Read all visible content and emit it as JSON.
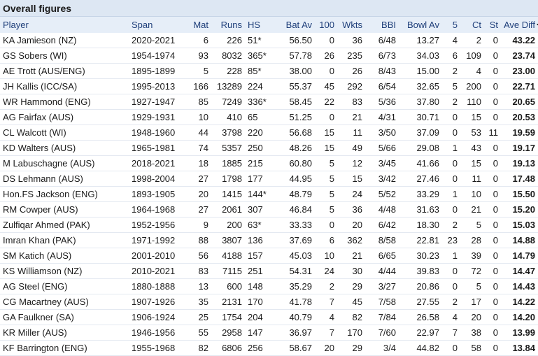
{
  "caption": "Overall figures",
  "columns": {
    "player": "Player",
    "span": "Span",
    "mat": "Mat",
    "runs": "Runs",
    "hs": "HS",
    "batav": "Bat Av",
    "hundreds": "100",
    "wkts": "Wkts",
    "bbi": "BBI",
    "bowlav": "Bowl Av",
    "five": "5",
    "ct": "Ct",
    "st": "St",
    "avediff": "Ave Diff"
  },
  "rows": [
    {
      "player": "KA Jamieson (NZ)",
      "span": "2020-2021",
      "mat": "6",
      "runs": "226",
      "hs": "51*",
      "batav": "56.50",
      "hundreds": "0",
      "wkts": "36",
      "bbi": "6/48",
      "bowlav": "13.27",
      "five": "4",
      "ct": "2",
      "st": "0",
      "avediff": "43.22"
    },
    {
      "player": "GS Sobers (WI)",
      "span": "1954-1974",
      "mat": "93",
      "runs": "8032",
      "hs": "365*",
      "batav": "57.78",
      "hundreds": "26",
      "wkts": "235",
      "bbi": "6/73",
      "bowlav": "34.03",
      "five": "6",
      "ct": "109",
      "st": "0",
      "avediff": "23.74"
    },
    {
      "player": "AE Trott (AUS/ENG)",
      "span": "1895-1899",
      "mat": "5",
      "runs": "228",
      "hs": "85*",
      "batav": "38.00",
      "hundreds": "0",
      "wkts": "26",
      "bbi": "8/43",
      "bowlav": "15.00",
      "five": "2",
      "ct": "4",
      "st": "0",
      "avediff": "23.00"
    },
    {
      "player": "JH Kallis (ICC/SA)",
      "span": "1995-2013",
      "mat": "166",
      "runs": "13289",
      "hs": "224",
      "batav": "55.37",
      "hundreds": "45",
      "wkts": "292",
      "bbi": "6/54",
      "bowlav": "32.65",
      "five": "5",
      "ct": "200",
      "st": "0",
      "avediff": "22.71"
    },
    {
      "player": "WR Hammond (ENG)",
      "span": "1927-1947",
      "mat": "85",
      "runs": "7249",
      "hs": "336*",
      "batav": "58.45",
      "hundreds": "22",
      "wkts": "83",
      "bbi": "5/36",
      "bowlav": "37.80",
      "five": "2",
      "ct": "110",
      "st": "0",
      "avediff": "20.65"
    },
    {
      "player": "AG Fairfax (AUS)",
      "span": "1929-1931",
      "mat": "10",
      "runs": "410",
      "hs": "65",
      "batav": "51.25",
      "hundreds": "0",
      "wkts": "21",
      "bbi": "4/31",
      "bowlav": "30.71",
      "five": "0",
      "ct": "15",
      "st": "0",
      "avediff": "20.53"
    },
    {
      "player": "CL Walcott (WI)",
      "span": "1948-1960",
      "mat": "44",
      "runs": "3798",
      "hs": "220",
      "batav": "56.68",
      "hundreds": "15",
      "wkts": "11",
      "bbi": "3/50",
      "bowlav": "37.09",
      "five": "0",
      "ct": "53",
      "st": "11",
      "avediff": "19.59"
    },
    {
      "player": "KD Walters (AUS)",
      "span": "1965-1981",
      "mat": "74",
      "runs": "5357",
      "hs": "250",
      "batav": "48.26",
      "hundreds": "15",
      "wkts": "49",
      "bbi": "5/66",
      "bowlav": "29.08",
      "five": "1",
      "ct": "43",
      "st": "0",
      "avediff": "19.17"
    },
    {
      "player": "M Labuschagne (AUS)",
      "span": "2018-2021",
      "mat": "18",
      "runs": "1885",
      "hs": "215",
      "batav": "60.80",
      "hundreds": "5",
      "wkts": "12",
      "bbi": "3/45",
      "bowlav": "41.66",
      "five": "0",
      "ct": "15",
      "st": "0",
      "avediff": "19.13"
    },
    {
      "player": "DS Lehmann (AUS)",
      "span": "1998-2004",
      "mat": "27",
      "runs": "1798",
      "hs": "177",
      "batav": "44.95",
      "hundreds": "5",
      "wkts": "15",
      "bbi": "3/42",
      "bowlav": "27.46",
      "five": "0",
      "ct": "11",
      "st": "0",
      "avediff": "17.48"
    },
    {
      "player": "Hon.FS Jackson (ENG)",
      "span": "1893-1905",
      "mat": "20",
      "runs": "1415",
      "hs": "144*",
      "batav": "48.79",
      "hundreds": "5",
      "wkts": "24",
      "bbi": "5/52",
      "bowlav": "33.29",
      "five": "1",
      "ct": "10",
      "st": "0",
      "avediff": "15.50"
    },
    {
      "player": "RM Cowper (AUS)",
      "span": "1964-1968",
      "mat": "27",
      "runs": "2061",
      "hs": "307",
      "batav": "46.84",
      "hundreds": "5",
      "wkts": "36",
      "bbi": "4/48",
      "bowlav": "31.63",
      "five": "0",
      "ct": "21",
      "st": "0",
      "avediff": "15.20"
    },
    {
      "player": "Zulfiqar Ahmed (PAK)",
      "span": "1952-1956",
      "mat": "9",
      "runs": "200",
      "hs": "63*",
      "batav": "33.33",
      "hundreds": "0",
      "wkts": "20",
      "bbi": "6/42",
      "bowlav": "18.30",
      "five": "2",
      "ct": "5",
      "st": "0",
      "avediff": "15.03"
    },
    {
      "player": "Imran Khan (PAK)",
      "span": "1971-1992",
      "mat": "88",
      "runs": "3807",
      "hs": "136",
      "batav": "37.69",
      "hundreds": "6",
      "wkts": "362",
      "bbi": "8/58",
      "bowlav": "22.81",
      "five": "23",
      "ct": "28",
      "st": "0",
      "avediff": "14.88"
    },
    {
      "player": "SM Katich (AUS)",
      "span": "2001-2010",
      "mat": "56",
      "runs": "4188",
      "hs": "157",
      "batav": "45.03",
      "hundreds": "10",
      "wkts": "21",
      "bbi": "6/65",
      "bowlav": "30.23",
      "five": "1",
      "ct": "39",
      "st": "0",
      "avediff": "14.79"
    },
    {
      "player": "KS Williamson (NZ)",
      "span": "2010-2021",
      "mat": "83",
      "runs": "7115",
      "hs": "251",
      "batav": "54.31",
      "hundreds": "24",
      "wkts": "30",
      "bbi": "4/44",
      "bowlav": "39.83",
      "five": "0",
      "ct": "72",
      "st": "0",
      "avediff": "14.47"
    },
    {
      "player": "AG Steel (ENG)",
      "span": "1880-1888",
      "mat": "13",
      "runs": "600",
      "hs": "148",
      "batav": "35.29",
      "hundreds": "2",
      "wkts": "29",
      "bbi": "3/27",
      "bowlav": "20.86",
      "five": "0",
      "ct": "5",
      "st": "0",
      "avediff": "14.43"
    },
    {
      "player": "CG Macartney (AUS)",
      "span": "1907-1926",
      "mat": "35",
      "runs": "2131",
      "hs": "170",
      "batav": "41.78",
      "hundreds": "7",
      "wkts": "45",
      "bbi": "7/58",
      "bowlav": "27.55",
      "five": "2",
      "ct": "17",
      "st": "0",
      "avediff": "14.22"
    },
    {
      "player": "GA Faulkner (SA)",
      "span": "1906-1924",
      "mat": "25",
      "runs": "1754",
      "hs": "204",
      "batav": "40.79",
      "hundreds": "4",
      "wkts": "82",
      "bbi": "7/84",
      "bowlav": "26.58",
      "five": "4",
      "ct": "20",
      "st": "0",
      "avediff": "14.20"
    },
    {
      "player": "KR Miller (AUS)",
      "span": "1946-1956",
      "mat": "55",
      "runs": "2958",
      "hs": "147",
      "batav": "36.97",
      "hundreds": "7",
      "wkts": "170",
      "bbi": "7/60",
      "bowlav": "22.97",
      "five": "7",
      "ct": "38",
      "st": "0",
      "avediff": "13.99"
    },
    {
      "player": "KF Barrington (ENG)",
      "span": "1955-1968",
      "mat": "82",
      "runs": "6806",
      "hs": "256",
      "batav": "58.67",
      "hundreds": "20",
      "wkts": "29",
      "bbi": "3/4",
      "bowlav": "44.82",
      "five": "0",
      "ct": "58",
      "st": "0",
      "avediff": "13.84"
    }
  ],
  "sort_icon": "sort-descending-icon"
}
